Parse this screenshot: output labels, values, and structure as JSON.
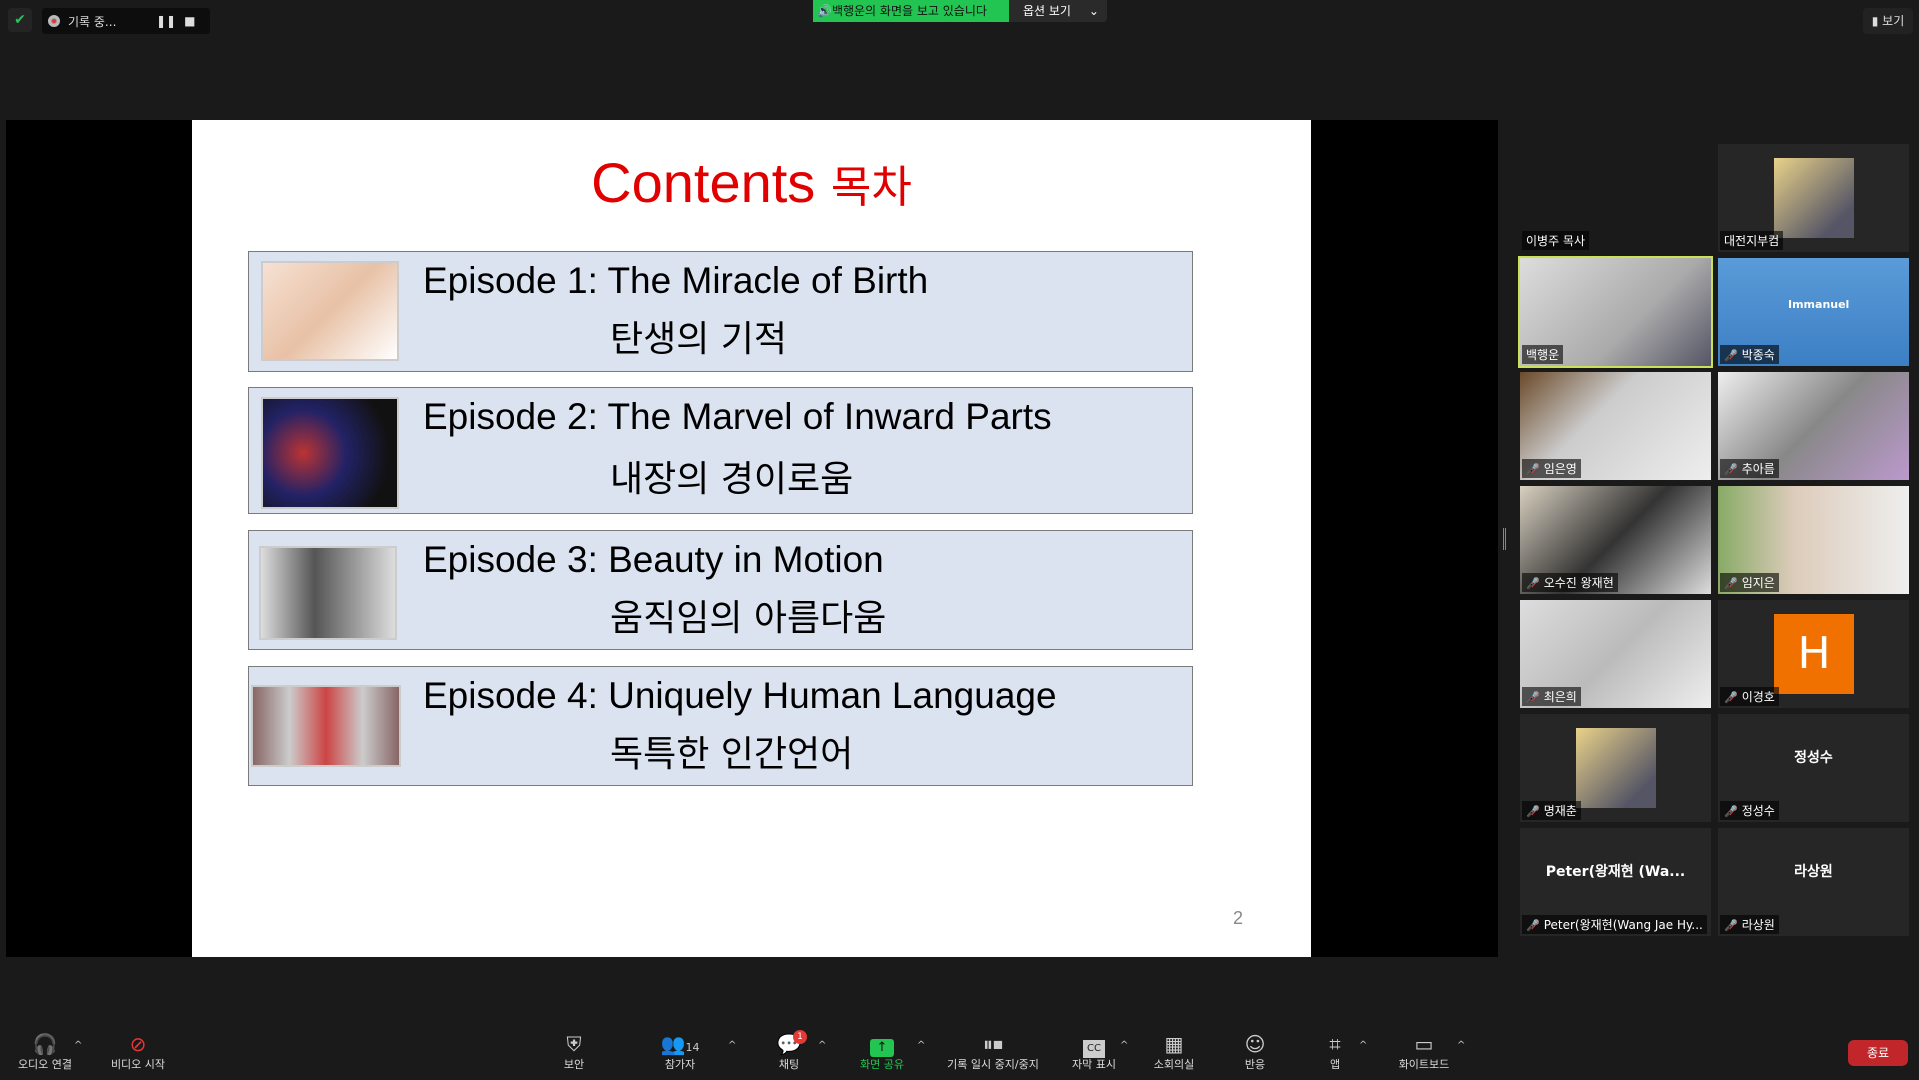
{
  "topbar": {
    "recording_label": "기록 중...",
    "share_banner": "🔊백행운의 화면을 보고 있습니다",
    "view_options": "옵션 보기",
    "view_button": "보기"
  },
  "slide": {
    "title_en": "Contents",
    "title_ko": "목차",
    "page": "2",
    "episodes": [
      {
        "en": "Episode 1: The Miracle of Birth",
        "ko": "탄생의 기적"
      },
      {
        "en": "Episode 2: The Marvel of Inward Parts",
        "ko": "내장의 경이로움"
      },
      {
        "en": "Episode 3: Beauty in Motion",
        "ko": "움직임의 아름다움"
      },
      {
        "en": "Episode 4: Uniquely Human Language",
        "ko": "독특한 인간언어"
      }
    ]
  },
  "participants": [
    {
      "name": "이병주 목사",
      "muted": false
    },
    {
      "name": "대전지부컴",
      "muted": false
    },
    {
      "name": "백행운",
      "muted": false,
      "active": true
    },
    {
      "name": "박종숙",
      "muted": true,
      "bg_text": "Immanuel"
    },
    {
      "name": "임은영",
      "muted": true
    },
    {
      "name": "추아름",
      "muted": true
    },
    {
      "name": "오수진 왕재현",
      "muted": true
    },
    {
      "name": "임지은",
      "muted": true
    },
    {
      "name": "최은희",
      "muted": true
    },
    {
      "name": "이경호",
      "muted": true,
      "avatar": "H",
      "avatar_color": "#f07000"
    },
    {
      "name": "명재춘",
      "muted": true
    },
    {
      "name": "정성수",
      "muted": true,
      "center": "정성수"
    },
    {
      "name": "Peter(왕재현(Wang Jae Hy...",
      "muted": true,
      "center": "Peter(왕재현 (Wa..."
    },
    {
      "name": "라상원",
      "muted": true,
      "center": "라상원"
    }
  ],
  "toolbar": {
    "audio": "오디오 연결",
    "video": "비디오 시작",
    "security": "보안",
    "participants": "참가자",
    "participant_count": "14",
    "chat": "채팅",
    "chat_badge": "1",
    "share": "화면 공유",
    "record": "기록 일시 중지/중지",
    "captions": "자막 표시",
    "breakout": "소회의실",
    "reactions": "반응",
    "apps": "앱",
    "whiteboard": "화이트보드",
    "end": "종료"
  }
}
